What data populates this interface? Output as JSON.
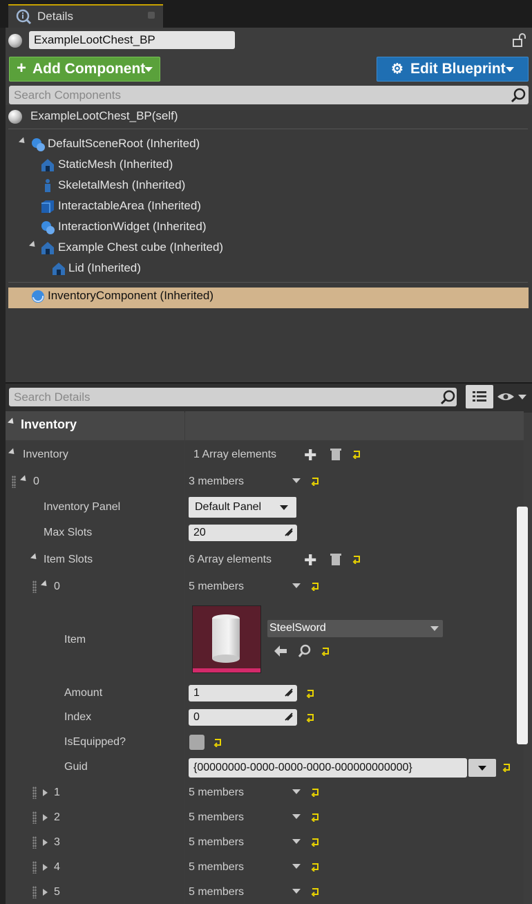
{
  "tab": {
    "title": "Details"
  },
  "header": {
    "actor_name": "ExampleLootChest_BP"
  },
  "toolbar": {
    "add_component": "Add Component",
    "edit_blueprint": "Edit Blueprint"
  },
  "component_search": {
    "placeholder": "Search Components"
  },
  "components": {
    "self": "ExampleLootChest_BP(self)",
    "items": [
      {
        "label": "DefaultSceneRoot (Inherited)",
        "icon": "scene-root-icon"
      },
      {
        "label": "StaticMesh (Inherited)",
        "icon": "static-mesh-icon"
      },
      {
        "label": "SkeletalMesh (Inherited)",
        "icon": "skeletal-mesh-icon"
      },
      {
        "label": "InteractableArea (Inherited)",
        "icon": "box-collision-icon"
      },
      {
        "label": "InteractionWidget (Inherited)",
        "icon": "widget-icon"
      },
      {
        "label": "Example Chest cube (Inherited)",
        "icon": "static-mesh-icon"
      },
      {
        "label": "Lid (Inherited)",
        "icon": "static-mesh-icon"
      },
      {
        "label": "InventoryComponent (Inherited)",
        "icon": "actor-component-icon"
      }
    ]
  },
  "details_search": {
    "placeholder": "Search Details"
  },
  "details": {
    "section": "Inventory",
    "inventory_label": "Inventory",
    "inventory_value": "1 Array elements",
    "elem0_label": "0",
    "elem0_value": "3 members",
    "panel_label": "Inventory Panel",
    "panel_value": "Default Panel",
    "maxslots_label": "Max Slots",
    "maxslots_value": "20",
    "itemslots_label": "Item Slots",
    "itemslots_value": "6 Array elements",
    "slot0_label": "0",
    "slot0_value": "5 members",
    "item_label": "Item",
    "item_value": "SteelSword",
    "amount_label": "Amount",
    "amount_value": "1",
    "index_label": "Index",
    "index_value": "0",
    "equipped_label": "IsEquipped?",
    "guid_label": "Guid",
    "guid_value": "{00000000-0000-0000-0000-000000000000}",
    "slots": [
      {
        "label": "1",
        "value": "5 members"
      },
      {
        "label": "2",
        "value": "5 members"
      },
      {
        "label": "3",
        "value": "5 members"
      },
      {
        "label": "4",
        "value": "5 members"
      },
      {
        "label": "5",
        "value": "5 members"
      }
    ]
  },
  "colors": {
    "add_green": "#5aa13b",
    "edit_blue": "#1f6fb3",
    "selected_row": "#d2b48c",
    "reset_yellow": "#e8d200"
  }
}
